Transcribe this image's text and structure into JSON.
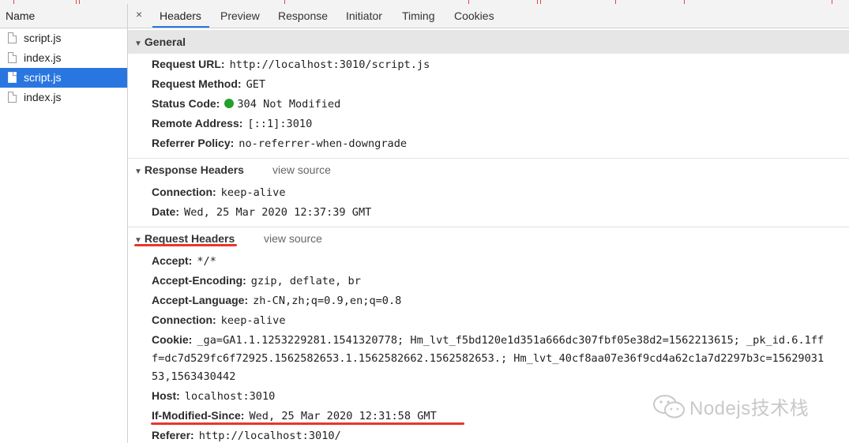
{
  "left_panel": {
    "header": "Name",
    "files": [
      {
        "name": "script.js",
        "selected": false
      },
      {
        "name": "index.js",
        "selected": false
      },
      {
        "name": "script.js",
        "selected": true
      },
      {
        "name": "index.js",
        "selected": false
      }
    ]
  },
  "tabs": {
    "close": "×",
    "items": [
      "Headers",
      "Preview",
      "Response",
      "Initiator",
      "Timing",
      "Cookies"
    ],
    "active": "Headers"
  },
  "general": {
    "title": "General",
    "rows": [
      {
        "key": "Request URL:",
        "value": "http://localhost:3010/script.js"
      },
      {
        "key": "Request Method:",
        "value": "GET"
      },
      {
        "key": "Status Code:",
        "value": "304 Not Modified"
      },
      {
        "key": "Remote Address:",
        "value": "[::1]:3010"
      },
      {
        "key": "Referrer Policy:",
        "value": "no-referrer-when-downgrade"
      }
    ]
  },
  "response_headers": {
    "title": "Response Headers",
    "view_source": "view source",
    "rows": [
      {
        "key": "Connection:",
        "value": "keep-alive"
      },
      {
        "key": "Date:",
        "value": "Wed, 25 Mar 2020 12:37:39 GMT"
      }
    ]
  },
  "request_headers": {
    "title": "Request Headers",
    "view_source": "view source",
    "rows": [
      {
        "key": "Accept:",
        "value": "*/*"
      },
      {
        "key": "Accept-Encoding:",
        "value": "gzip, deflate, br"
      },
      {
        "key": "Accept-Language:",
        "value": "zh-CN,zh;q=0.9,en;q=0.8"
      },
      {
        "key": "Connection:",
        "value": "keep-alive"
      },
      {
        "key": "Cookie:",
        "value": "_ga=GA1.1.1253229281.1541320778; Hm_lvt_f5bd120e1d351a666dc307fbf05e38d2=1562213615; _pk_id.6.1ff"
      },
      {
        "key": "Host:",
        "value": "localhost:3010"
      },
      {
        "key": "If-Modified-Since:",
        "value": "Wed, 25 Mar 2020 12:31:58 GMT"
      },
      {
        "key": "Referer:",
        "value": "http://localhost:3010/"
      }
    ],
    "cookie_continuation": [
      "f=dc7d529fc6f72925.1562582653.1.1562582662.1562582653.; Hm_lvt_40cf8aa07e36f9cd4a62c1a7d2297b3c=15629031",
      "53,1563430442"
    ]
  },
  "watermark": "Nodejs技术栈",
  "colors": {
    "selection": "#2a76e0",
    "status_dot": "#21a02b",
    "annotation_underline": "#e8362b"
  }
}
